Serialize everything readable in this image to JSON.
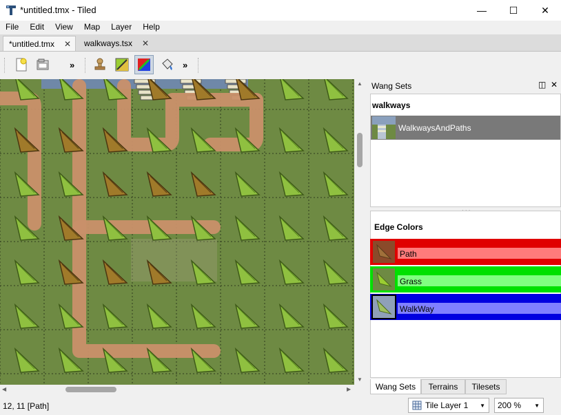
{
  "window": {
    "title": "*untitled.tmx - Tiled",
    "minimize_glyph": "—",
    "maximize_glyph": "☐",
    "close_glyph": "✕"
  },
  "menu": [
    "File",
    "Edit",
    "View",
    "Map",
    "Layer",
    "Help"
  ],
  "tabs": [
    {
      "label": "*untitled.tmx",
      "close": "✕",
      "active": true
    },
    {
      "label": "walkways.tsx",
      "close": "✕",
      "active": false
    }
  ],
  "toolbar": {
    "overflow_left": "»",
    "overflow_right": "»",
    "buttons": [
      {
        "name": "new-map",
        "icon": "new-file-icon"
      },
      {
        "name": "open",
        "icon": "open-folder-icon"
      },
      {
        "name": "stamp-brush",
        "icon": "stamp-icon"
      },
      {
        "name": "terrain-brush",
        "icon": "terrain-brush-icon"
      },
      {
        "name": "wang-brush",
        "icon": "wang-brush-icon",
        "active": true
      },
      {
        "name": "bucket-fill",
        "icon": "bucket-fill-icon"
      }
    ]
  },
  "wang_panel": {
    "title": "Wang Sets",
    "float_glyph": "◫",
    "close_glyph": "✕",
    "tileset_name": "walkways",
    "sets": [
      {
        "label": "WalkwaysAndPaths",
        "selected": true
      }
    ],
    "edge_colors_title": "Edge Colors",
    "edge_colors": [
      {
        "label": "Path",
        "color": "#e00000",
        "light": "#ff7b7b",
        "swatch": "#8a5a2a"
      },
      {
        "label": "Grass",
        "color": "#00e000",
        "light": "#80ff80",
        "swatch": "#7fb241"
      },
      {
        "label": "WalkWay",
        "color": "#0000e0",
        "light": "#8080ff",
        "swatch": "#9fb0c8"
      }
    ],
    "bottom_tabs": [
      "Wang Sets",
      "Terrains",
      "Tilesets"
    ]
  },
  "status": {
    "position": "12, 11 [Path]",
    "layer": "Tile Layer 1",
    "zoom": "200 %",
    "dropdown_glyph": "▼"
  },
  "colors": {
    "grass": "#6e8a43",
    "path": "#c9906a",
    "walkway": "#6f88a8",
    "selected_row": "#797979"
  }
}
